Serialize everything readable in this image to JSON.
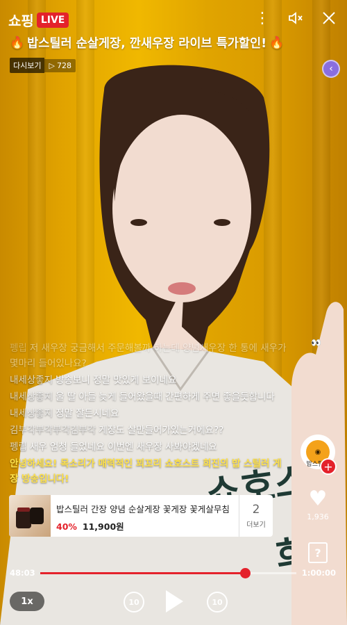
{
  "header": {
    "brand": "쇼핑",
    "live_badge": "LIVE",
    "more_icon": "more-vert-icon",
    "mute_icon": "volume-mute-icon",
    "close_icon": "close-icon"
  },
  "title": {
    "left_icon": "fire-icon",
    "text": "밥스틸러 순살게장, 깐새우장 라이브 특가할인!",
    "right_icon": "fire-icon"
  },
  "replay": {
    "badge": "다시보기",
    "views": "728"
  },
  "chat": [
    {
      "user": "펭립",
      "msg": "저 새우장 궁금해서 주문해볼까 하는데 양념새우장 한 통에 새우가 몇마리 들어있나요?",
      "faded": true
    },
    {
      "user": "내세상좋지",
      "msg": "방송보니 정말 맛있게 보이네요",
      "faded": false
    },
    {
      "user": "내세상좋지",
      "msg": "울 딸 아들 늦게 들어왔을때 간편하게 주면 좋을듯합니다",
      "faded": false
    },
    {
      "user": "내세상좋지",
      "msg": "정말 잘든시네요",
      "faded": false
    },
    {
      "user": "김부각부각부각김부각",
      "msg": "게장도 살만들어가있는거에요??",
      "faded": false
    },
    {
      "user": "펭립",
      "msg": "새우 엄청 들었네요 이번엔 새우장 사봐야겠네요",
      "faded": false
    }
  ],
  "notice": "안녕하세요! 목소리가 매력적인 꾀꼬리 쇼호스트 희진의 밥 스틸러 게장 방송입니다!",
  "product": {
    "name": "밥스틸러 간장 양념 순살게장 꽃게장 꽃게살무침",
    "discount": "40%",
    "price": "11,900원",
    "more_count": "2",
    "more_label": "더보기"
  },
  "rail": {
    "channel_name": "밥스틸러",
    "likes": "1,936",
    "help_label": "?"
  },
  "player": {
    "current_time": "48:03",
    "total_time": "1:00:00",
    "progress": 0.8,
    "speed": "1x",
    "rewind_label": "10",
    "forward_label": "10"
  },
  "colors": {
    "accent": "#e4222b",
    "notice": "#ffe24a",
    "background": "#e8ad00"
  }
}
